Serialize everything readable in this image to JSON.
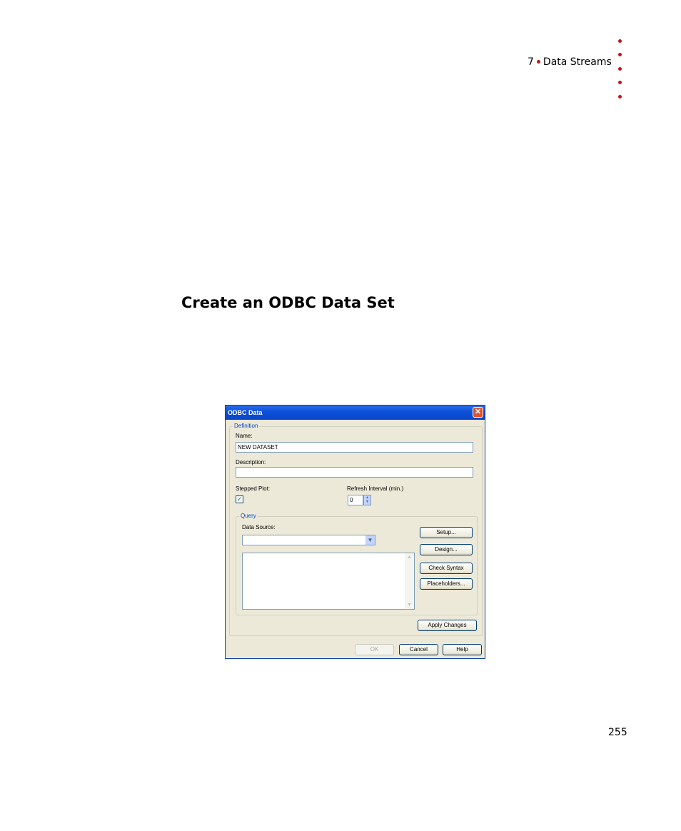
{
  "header": {
    "chapter_number": "7",
    "chapter_title": "Data Streams"
  },
  "section_heading": "Create an ODBC Data Set",
  "page_number": "255",
  "dialog": {
    "title": "ODBC Data",
    "definition_legend": "Definition",
    "name_label": "Name:",
    "name_value": "NEW DATASET",
    "description_label": "Description:",
    "description_value": "",
    "stepped_plot_label": "Stepped Plot:",
    "stepped_plot_checked": true,
    "refresh_label": "Refresh Interval (min.)",
    "refresh_value": "0",
    "query_legend": "Query",
    "data_source_label": "Data Source:",
    "data_source_value": "",
    "buttons": {
      "setup": "Setup...",
      "design": "Design...",
      "check_syntax": "Check Syntax",
      "placeholders": "Placeholders...",
      "apply_changes": "Apply Changes",
      "ok": "OK",
      "cancel": "Cancel",
      "help": "Help"
    }
  },
  "colors": {
    "accent_red": "#c0161b",
    "title_bar_blue": "#0b4fd6",
    "dialog_background": "#ece9d8"
  }
}
